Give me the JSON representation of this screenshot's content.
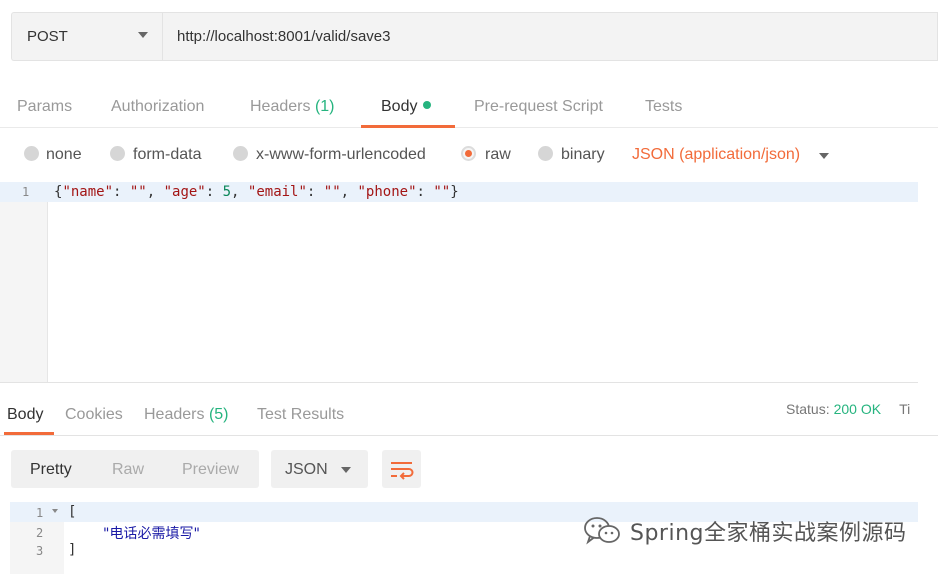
{
  "request": {
    "method": "POST",
    "url": "http://localhost:8001/valid/save3"
  },
  "request_tabs": [
    {
      "label": "Params"
    },
    {
      "label": "Authorization"
    },
    {
      "label": "Headers",
      "count": "(1)"
    },
    {
      "label": "Body",
      "active": true
    },
    {
      "label": "Pre-request Script"
    },
    {
      "label": "Tests"
    }
  ],
  "body_types": [
    {
      "label": "none"
    },
    {
      "label": "form-data"
    },
    {
      "label": "x-www-form-urlencoded"
    },
    {
      "label": "raw",
      "selected": true
    },
    {
      "label": "binary"
    }
  ],
  "content_type": "JSON (application/json)",
  "request_body": {
    "line_number": "1",
    "open": "{",
    "k1": "\"name\"",
    "v1": "\"\"",
    "k2": "\"age\"",
    "v2": "5",
    "k3": "\"email\"",
    "v3": "\"\"",
    "k4": "\"phone\"",
    "v4": "\"\"",
    "close": "}"
  },
  "response_tabs": [
    {
      "label": "Body",
      "active": true
    },
    {
      "label": "Cookies"
    },
    {
      "label": "Headers",
      "count": "(5)"
    },
    {
      "label": "Test Results"
    }
  ],
  "status": {
    "label": "Status:",
    "value": "200 OK",
    "next": "Ti"
  },
  "view_modes": [
    "Pretty",
    "Raw",
    "Preview"
  ],
  "response_format": "JSON",
  "response_body": {
    "lines": [
      "1",
      "2",
      "3"
    ],
    "open": "[",
    "message": "\"电话必需填写\"",
    "close": "]"
  },
  "watermark": "Spring全家桶实战案例源码",
  "colors": {
    "accent": "#f26b3a",
    "success": "#26b47f"
  }
}
